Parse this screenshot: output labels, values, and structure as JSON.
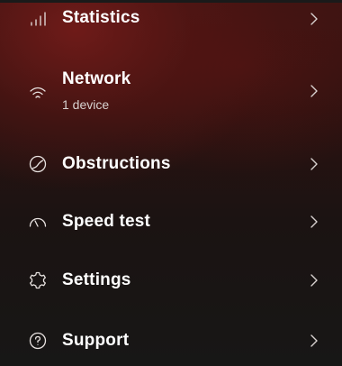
{
  "menu": {
    "items": [
      {
        "id": "statistics",
        "label": "Statistics",
        "icon": "signal-bars-icon"
      },
      {
        "id": "network",
        "label": "Network",
        "sublabel": "1 device",
        "icon": "wifi-icon"
      },
      {
        "id": "obstructions",
        "label": "Obstructions",
        "icon": "obstructions-icon"
      },
      {
        "id": "speed-test",
        "label": "Speed test",
        "icon": "speedometer-icon"
      },
      {
        "id": "settings",
        "label": "Settings",
        "icon": "gear-icon"
      },
      {
        "id": "support",
        "label": "Support",
        "icon": "question-circle-icon"
      }
    ],
    "chevron_icon": "chevron-right-icon"
  },
  "colors": {
    "background_top": "#3c1412",
    "background_bottom": "#171716",
    "text": "#ffffff",
    "subtext": "#d8d2d0"
  }
}
